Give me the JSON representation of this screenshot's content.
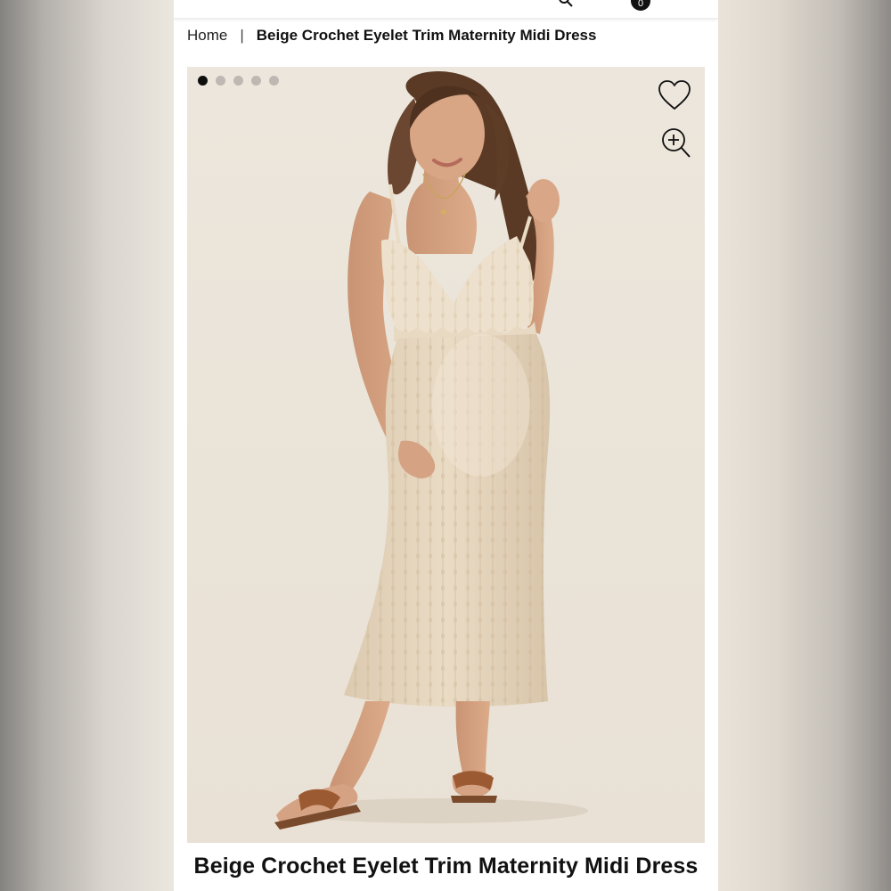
{
  "breadcrumb": {
    "home": "Home",
    "separator": "|",
    "current": "Beige Crochet Eyelet Trim Maternity Midi Dress"
  },
  "cart": {
    "count": "0"
  },
  "gallery": {
    "image_count": 5,
    "active_index": 0,
    "image_alt": "Model wearing beige crochet eyelet trim maternity midi dress with brown slide sandals"
  },
  "product": {
    "title": "Beige Crochet Eyelet Trim Maternity Midi Dress"
  },
  "icons": {
    "wishlist": "heart-icon",
    "zoom": "zoom-in-icon",
    "search": "search-icon"
  },
  "colors": {
    "photo_background": "#ece5da",
    "dress": "#e6d6bf",
    "active_dot": "#0e0e0e",
    "inactive_dot": "#bdb8b1"
  }
}
